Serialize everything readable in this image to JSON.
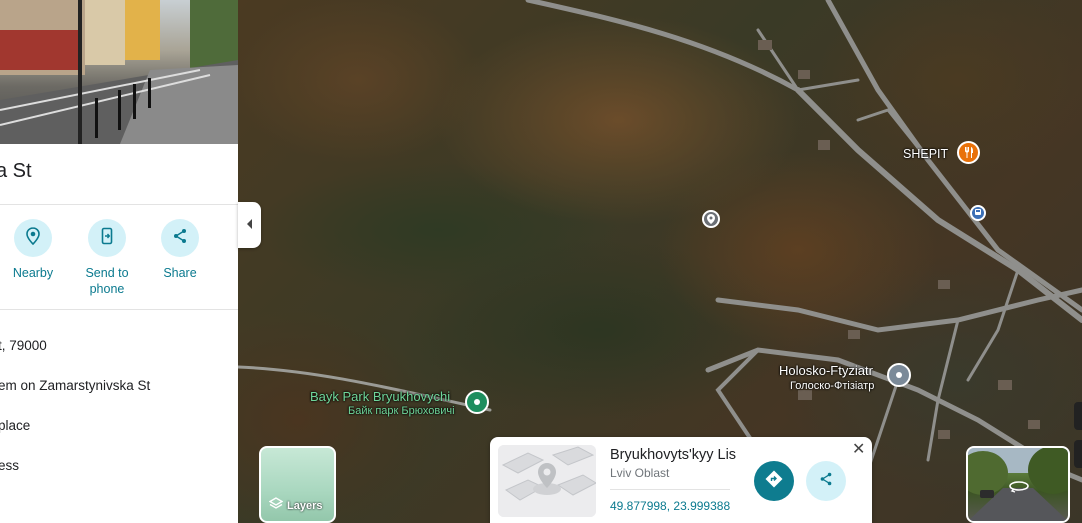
{
  "panel": {
    "title": "a St",
    "actions": [
      {
        "label": "Nearby",
        "icon": "nearby-icon"
      },
      {
        "label": "Send to phone",
        "icon": "send-to-phone-icon"
      },
      {
        "label": "Share",
        "icon": "share-icon"
      }
    ],
    "info": [
      "t, 79000",
      "em on Zamarstynivska St",
      "place",
      "ess"
    ]
  },
  "map": {
    "labels": {
      "shepit": "SHEPIT",
      "park_en": "Bayk Park Bryukhovychi",
      "park_uk": "Байк парк Брюховичі",
      "holosko_en": "Holosko-Ftyziatr",
      "holosko_uk": "Голоско-Фтізіатр"
    },
    "layers_label": "Layers"
  },
  "place_card": {
    "name": "Bryukhovyts'kyy Lis",
    "region": "Lviv Oblast",
    "coords": "49.877998, 23.999388",
    "close": "✕"
  },
  "colors": {
    "accent": "#0e7c8f",
    "accent_light": "#d3f1f8",
    "park_green": "#1e8e5e",
    "restaurant_orange": "#e8710a"
  }
}
